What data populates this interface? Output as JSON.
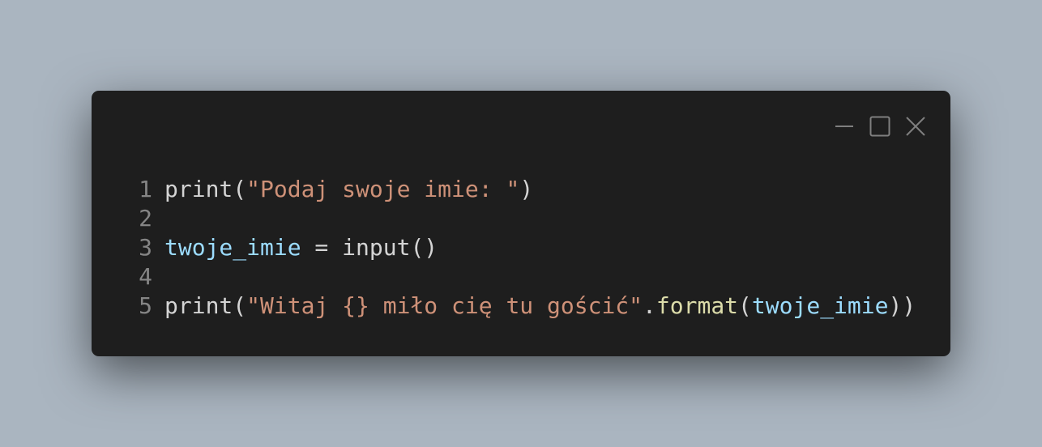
{
  "window": {
    "controls": [
      "minimize-icon",
      "maximize-icon",
      "close-icon"
    ],
    "colors": {
      "background": "#1e1e1e",
      "string": "#ce9178",
      "variable": "#9cdcfe",
      "method": "#dcdcaa",
      "text": "#d4d4d4",
      "line_number": "#858585"
    }
  },
  "code": {
    "lines": [
      {
        "n": "1",
        "t": [
          {
            "c": "fn",
            "v": "print("
          },
          {
            "c": "str",
            "v": "\"Podaj swoje imie: \""
          },
          {
            "c": "fn",
            "v": ")"
          }
        ]
      },
      {
        "n": "2",
        "t": []
      },
      {
        "n": "3",
        "t": [
          {
            "c": "var",
            "v": "twoje_imie"
          },
          {
            "c": "fn",
            "v": " = input()"
          }
        ]
      },
      {
        "n": "4",
        "t": []
      },
      {
        "n": "5",
        "t": [
          {
            "c": "fn",
            "v": "print("
          },
          {
            "c": "str",
            "v": "\"Witaj {} miło cię tu gościć\""
          },
          {
            "c": "fn",
            "v": "."
          },
          {
            "c": "meth",
            "v": "format"
          },
          {
            "c": "fn",
            "v": "("
          },
          {
            "c": "var",
            "v": "twoje_imie"
          },
          {
            "c": "fn",
            "v": "))"
          }
        ]
      }
    ]
  }
}
